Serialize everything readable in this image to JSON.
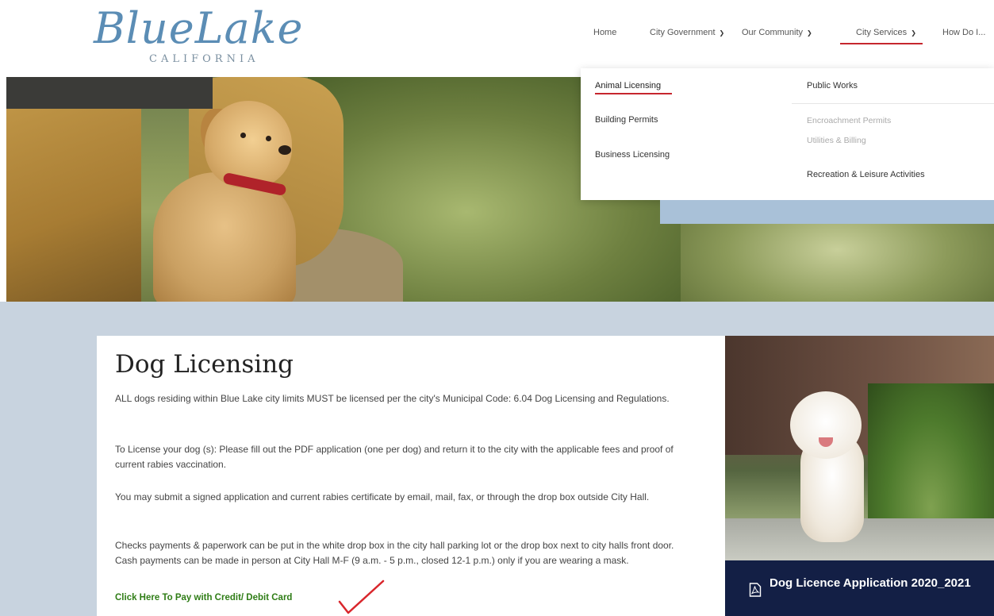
{
  "header": {
    "logo_script": "BlueLake",
    "logo_sub": "CALIFORNIA",
    "nav": [
      {
        "label": "Home",
        "has_dropdown": false
      },
      {
        "label": "City Government",
        "has_dropdown": true
      },
      {
        "label": "Our Community",
        "has_dropdown": true
      },
      {
        "label": "City Services",
        "has_dropdown": true,
        "active": true
      },
      {
        "label": "How Do I...",
        "has_dropdown": true
      }
    ]
  },
  "dropdown": {
    "left_column": [
      {
        "label": "Animal Licensing",
        "active": true
      },
      {
        "label": "Building Permits"
      },
      {
        "label": "Business Licensing"
      }
    ],
    "right_column": {
      "heading": "Public Works",
      "sub_items": [
        "Encroachment Permits",
        "Utilities & Billing"
      ],
      "extra": "Recreation & Leisure Activities"
    }
  },
  "content": {
    "title": "Dog Licensing",
    "paragraphs": [
      "ALL dogs residing within Blue Lake city limits MUST be licensed per the city's Municipal Code: 6.04 Dog Licensing and Regulations.",
      "To License your dog (s): Please fill out the PDF application (one per dog) and return it to the city with the applicable fees and proof of current rabies vaccination.",
      "You may submit a signed application and current rabies certificate by email, mail, fax, or through the drop box outside City Hall.",
      "Checks payments & paperwork can be put in the white drop box in the city hall parking lot or the drop box next to city halls front door. Cash payments can be made in person at City Hall M-F (9 a.m. - 5 p.m., closed 12-1 p.m.) only if you are wearing a mask."
    ],
    "pay_link": "Click Here To Pay with Credit/ Debit Card"
  },
  "sidebar": {
    "pdf_label": "Dog Licence Application 2020_2021",
    "pdf_icon": "pdf-file-icon"
  },
  "colors": {
    "accent_red": "#c6262e",
    "link_green": "#2f7d16",
    "navy": "#131f45",
    "content_bg": "#c8d3df",
    "logo_blue": "#5b8db5"
  }
}
